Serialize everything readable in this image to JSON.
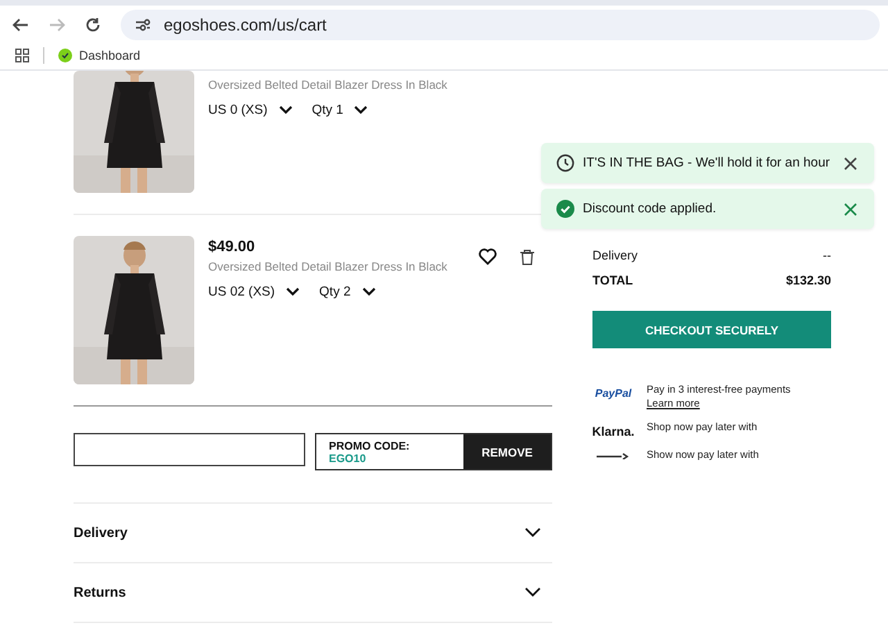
{
  "browser": {
    "url": "egoshoes.com/us/cart",
    "bookmarks": [
      {
        "label": "Dashboard"
      }
    ]
  },
  "cart": {
    "items": [
      {
        "cut": true,
        "description": "Oversized Belted Detail Blazer Dress In Black",
        "size": "US 0 (XS)",
        "qty": "Qty 1"
      },
      {
        "cut": false,
        "price": "$49.00",
        "description": "Oversized Belted Detail Blazer Dress In Black",
        "size": "US 02 (XS)",
        "qty": "Qty 2"
      }
    ],
    "promo": {
      "label": "PROMO CODE:",
      "code": "EGO10",
      "button": "REMOVE"
    },
    "sections": [
      {
        "label": "Delivery",
        "expanded": false
      },
      {
        "label": "Returns",
        "expanded": false
      }
    ]
  },
  "summary": {
    "rows": [
      {
        "kind": "line",
        "label": "Delivery",
        "value": "--"
      },
      {
        "kind": "total",
        "label": "TOTAL",
        "value": "$132.30"
      }
    ],
    "checkout": "CHECKOUT SECURELY",
    "payments": [
      {
        "kind": "paypal",
        "logo": "PayPal",
        "text": "Pay in 3 interest-free payments",
        "link": "Learn more"
      },
      {
        "kind": "klarna",
        "logo": "Klarna.",
        "text": "Shop now pay later with"
      },
      {
        "kind": "clearpay",
        "text": "Show now pay later with"
      }
    ]
  },
  "toasts": [
    {
      "kind": "clock",
      "text": "IT'S IN THE BAG - We'll hold it for an hour"
    },
    {
      "kind": "check",
      "text": "Discount code applied."
    }
  ]
}
